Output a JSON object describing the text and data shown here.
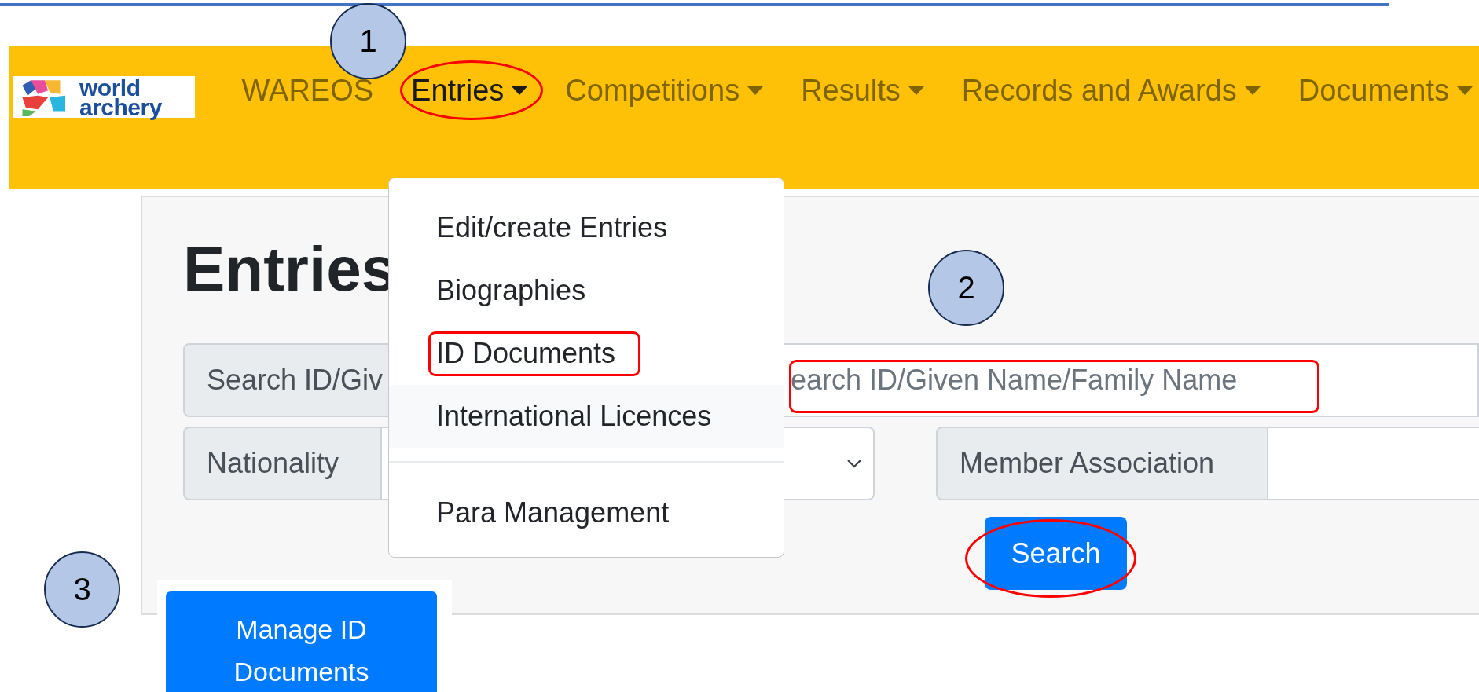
{
  "logo": {
    "text_lines": [
      "world",
      "archery"
    ]
  },
  "navbar": {
    "items": [
      {
        "label": "WAREOS",
        "dropdown": false,
        "selected": false,
        "highlighted": false
      },
      {
        "label": "Entries",
        "dropdown": true,
        "selected": true,
        "highlighted": true
      },
      {
        "label": "Competitions",
        "dropdown": true,
        "selected": false,
        "highlighted": false
      },
      {
        "label": "Results",
        "dropdown": true,
        "selected": false,
        "highlighted": false
      },
      {
        "label": "Records and Awards",
        "dropdown": true,
        "selected": false,
        "highlighted": false
      },
      {
        "label": "Documents",
        "dropdown": true,
        "selected": false,
        "highlighted": false
      }
    ]
  },
  "dropdown_menu": {
    "groups": [
      [
        {
          "label": "Edit/create Entries",
          "hovered": false,
          "highlighted": false
        },
        {
          "label": "Biographies",
          "hovered": false,
          "highlighted": false
        },
        {
          "label": "ID Documents",
          "hovered": false,
          "highlighted": true
        },
        {
          "label": "International Licences",
          "hovered": true,
          "highlighted": false
        }
      ],
      [
        {
          "label": "Para Management",
          "hovered": false,
          "highlighted": false
        }
      ]
    ]
  },
  "page": {
    "title": "Entries",
    "search": {
      "label": "Search ID/Giv",
      "placeholder": "earch ID/Given Name/Family Name",
      "highlighted": true
    },
    "nationality": {
      "label": "Nationality"
    },
    "member_association": {
      "label": "Member Association"
    },
    "search_button": {
      "label": "Search",
      "highlighted": true
    },
    "manage_button": {
      "label": "Manage ID Documents"
    }
  },
  "annotations": [
    {
      "kind": "number",
      "text": "1"
    },
    {
      "kind": "number",
      "text": "2"
    },
    {
      "kind": "number",
      "text": "3"
    }
  ]
}
